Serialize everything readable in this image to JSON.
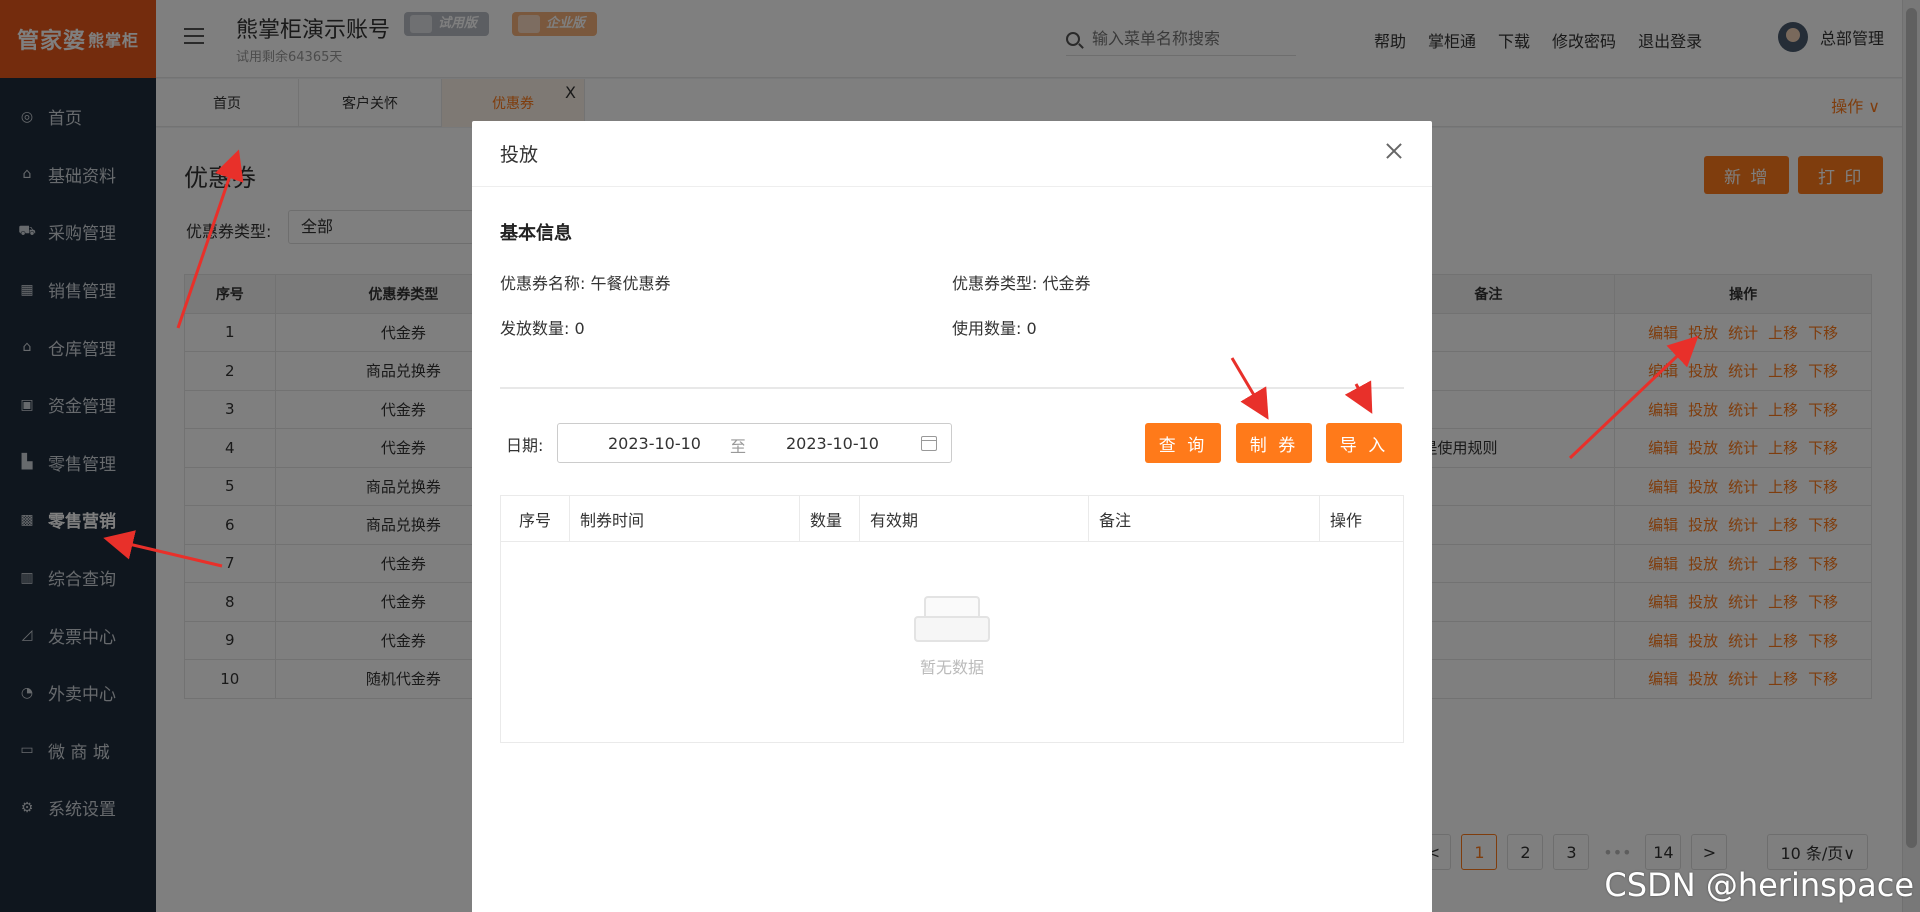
{
  "sidebar": {
    "logo_main": "管家婆",
    "logo_sub": "熊掌柜",
    "items": [
      {
        "label": "首页",
        "icon": "globe-icon"
      },
      {
        "label": "基础资料",
        "icon": "home-icon"
      },
      {
        "label": "采购管理",
        "icon": "cart-icon"
      },
      {
        "label": "销售管理",
        "icon": "calendar-icon"
      },
      {
        "label": "仓库管理",
        "icon": "warehouse-icon"
      },
      {
        "label": "资金管理",
        "icon": "money-icon"
      },
      {
        "label": "零售管理",
        "icon": "chart-icon"
      },
      {
        "label": "零售营销",
        "icon": "gift-icon"
      },
      {
        "label": "综合查询",
        "icon": "bar-chart-icon"
      },
      {
        "label": "发票中心",
        "icon": "line-chart-icon"
      },
      {
        "label": "外卖中心",
        "icon": "delivery-icon"
      },
      {
        "label": "微 商 城",
        "icon": "bag-icon"
      },
      {
        "label": "系统设置",
        "icon": "gear-icon"
      }
    ]
  },
  "header": {
    "account_title": "熊掌柜演示账号",
    "account_sub": "试用剩余64365天",
    "badge_trial": "试用版",
    "badge_ent": "企业版",
    "search_placeholder": "输入菜单名称搜索",
    "links": [
      "帮助",
      "掌柜通",
      "下载",
      "修改密码",
      "退出登录"
    ],
    "user": "总部管理"
  },
  "tabs": [
    {
      "label": "首页"
    },
    {
      "label": "客户关怀"
    },
    {
      "label": "优惠券"
    }
  ],
  "tab_close": "X",
  "ops_menu": "操作 ∨",
  "main": {
    "title": "优惠券",
    "btn_add": "新 增",
    "btn_print": "打 印",
    "filter_label": "优惠券类型:",
    "filter_value": "全部",
    "columns": [
      "序号",
      "优惠券类型",
      "备注",
      "操作"
    ],
    "rows": [
      {
        "no": "1",
        "type": "代金券",
        "note": ""
      },
      {
        "no": "2",
        "type": "商品兑换券",
        "note": ""
      },
      {
        "no": "3",
        "type": "代金券",
        "note": ""
      },
      {
        "no": "4",
        "type": "代金券",
        "note": "用规则这是使用规则"
      },
      {
        "no": "5",
        "type": "商品兑换券",
        "note": ""
      },
      {
        "no": "6",
        "type": "商品兑换券",
        "note": ""
      },
      {
        "no": "7",
        "type": "代金券",
        "note": ""
      },
      {
        "no": "8",
        "type": "代金券",
        "note": ""
      },
      {
        "no": "9",
        "type": "代金券",
        "note": ""
      },
      {
        "no": "10",
        "type": "随机代金券",
        "note": ""
      }
    ],
    "row_ops": [
      "编辑",
      "投放",
      "统计",
      "上移",
      "下移"
    ],
    "pager": {
      "prev": "<",
      "pages": [
        "1",
        "2",
        "3"
      ],
      "dots": "•••",
      "last": "14",
      "next": ">",
      "size": "10 条/页∨"
    }
  },
  "modal": {
    "title": "投放",
    "section": "基本信息",
    "name_label": "优惠券名称:",
    "name_value": "午餐优惠券",
    "type_label": "优惠券类型:",
    "type_value": "代金券",
    "issued_label": "发放数量:",
    "issued_value": "0",
    "used_label": "使用数量:",
    "used_value": "0",
    "date_label": "日期:",
    "date_from": "2023-10-10",
    "date_sep": "至",
    "date_to": "2023-10-10",
    "btn_query": "查 询",
    "btn_make": "制 券",
    "btn_import": "导 入",
    "columns": [
      "序号",
      "制券时间",
      "数量",
      "有效期",
      "备注",
      "操作"
    ],
    "empty_text": "暂无数据"
  },
  "watermark": "CSDN @herinspace"
}
